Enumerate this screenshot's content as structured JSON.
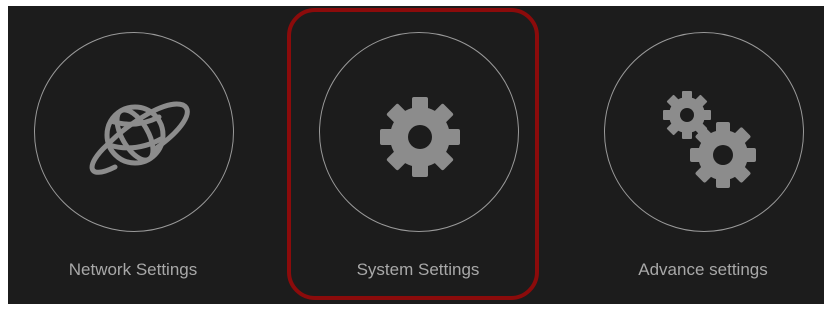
{
  "colors": {
    "panel_background": "#1c1c1c",
    "circle_border": "#9a9a9a",
    "icon": "#8c8c8c",
    "label_text": "#a8a8a8",
    "highlight": "#8b0b0b"
  },
  "tiles": [
    {
      "label": "Network Settings",
      "icon": "globe-network-icon"
    },
    {
      "label": "System Settings",
      "icon": "gear-icon",
      "highlighted": true
    },
    {
      "label": "Advance settings",
      "icon": "gears-icon"
    }
  ]
}
